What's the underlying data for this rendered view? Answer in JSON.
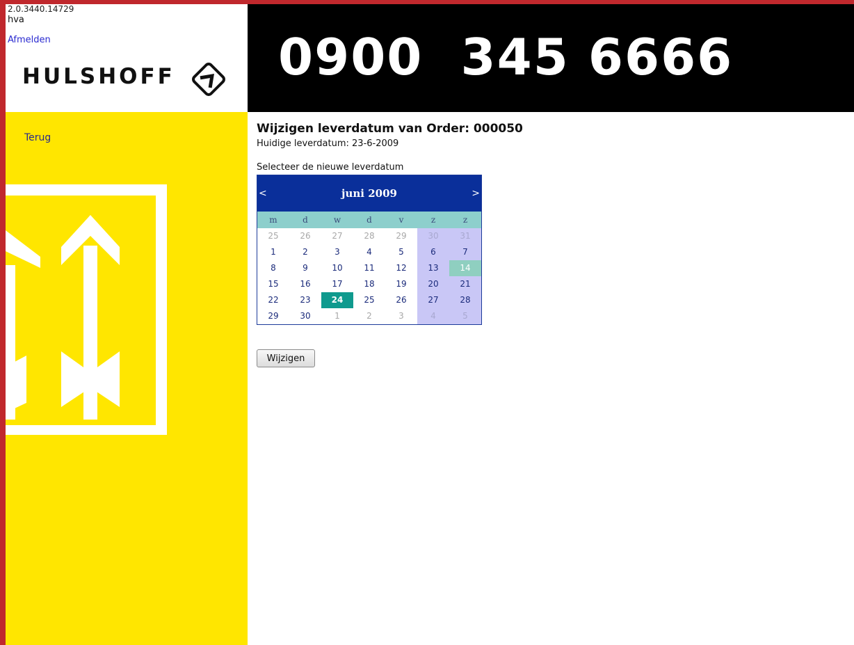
{
  "header": {
    "version": "2.0.3440.14729",
    "user": "hva",
    "logout_label": "Afmelden",
    "brand": "HULSHOFF",
    "brand_icon": "hulshoff-logo-icon",
    "phone": "0900  345 6666"
  },
  "sidebar": {
    "back_label": "Terug",
    "decoration_icon": "double-arrow-icon"
  },
  "main": {
    "title": "Wijzigen leverdatum van Order: 000050",
    "current_date": "Huidige leverdatum: 23-6-2009",
    "select_label": "Selecteer de nieuwe leverdatum",
    "submit_label": "Wijzigen"
  },
  "calendar": {
    "prev_label": "<",
    "next_label": ">",
    "month_label": "juni 2009",
    "weekdays": [
      "m",
      "d",
      "w",
      "d",
      "v",
      "z",
      "z"
    ],
    "weeks": [
      [
        {
          "d": "25",
          "o": 1
        },
        {
          "d": "26",
          "o": 1
        },
        {
          "d": "27",
          "o": 1
        },
        {
          "d": "28",
          "o": 1
        },
        {
          "d": "29",
          "o": 1
        },
        {
          "d": "30",
          "o": 1
        },
        {
          "d": "31",
          "o": 1
        }
      ],
      [
        {
          "d": "1"
        },
        {
          "d": "2"
        },
        {
          "d": "3"
        },
        {
          "d": "4"
        },
        {
          "d": "5"
        },
        {
          "d": "6"
        },
        {
          "d": "7"
        }
      ],
      [
        {
          "d": "8"
        },
        {
          "d": "9"
        },
        {
          "d": "10"
        },
        {
          "d": "11"
        },
        {
          "d": "12"
        },
        {
          "d": "13"
        },
        {
          "d": "14",
          "today": 1
        }
      ],
      [
        {
          "d": "15"
        },
        {
          "d": "16"
        },
        {
          "d": "17"
        },
        {
          "d": "18"
        },
        {
          "d": "19"
        },
        {
          "d": "20"
        },
        {
          "d": "21"
        }
      ],
      [
        {
          "d": "22"
        },
        {
          "d": "23"
        },
        {
          "d": "24",
          "sel": 1
        },
        {
          "d": "25"
        },
        {
          "d": "26"
        },
        {
          "d": "27"
        },
        {
          "d": "28"
        }
      ],
      [
        {
          "d": "29"
        },
        {
          "d": "30"
        },
        {
          "d": "1",
          "o": 1
        },
        {
          "d": "2",
          "o": 1
        },
        {
          "d": "3",
          "o": 1
        },
        {
          "d": "4",
          "o": 1
        },
        {
          "d": "5",
          "o": 1
        }
      ]
    ],
    "colors": {
      "header_bg": "#0a2f9a",
      "weekday_bg": "#8dcfcc",
      "weekend_bg": "#c9c7f6",
      "selected_bg": "#0f9a8e",
      "today_bg": "#8fcfc0"
    }
  },
  "colors": {
    "sidebar": "#ffe600",
    "frame": "#c0282d",
    "banner": "#000000"
  }
}
